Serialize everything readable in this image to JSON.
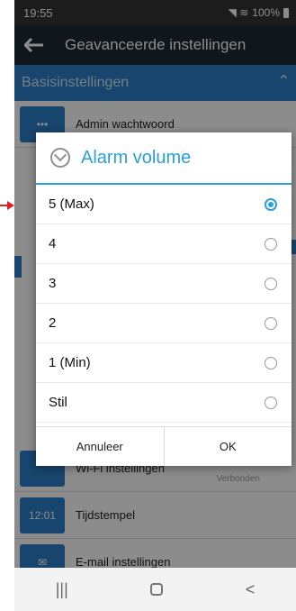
{
  "status": {
    "time": "19:55",
    "battery": "100%",
    "icons": "signal-wifi-icons"
  },
  "appbar": {
    "title": "Geavanceerde instellingen",
    "back_icon": "back-arrow-icon"
  },
  "section": {
    "title": "Basisinstellingen"
  },
  "rows": [
    {
      "label": "Admin wachtwoord",
      "icon_text": "•••",
      "sub": ""
    },
    {
      "label": "Wi-Fi instellingen",
      "icon_text": "",
      "sub": "Verbonden"
    },
    {
      "label": "Tijdstempel",
      "icon_text": "12:01",
      "sub": ""
    },
    {
      "label": "E-mail instellingen",
      "icon_text": "✉",
      "sub": ""
    }
  ],
  "dialog": {
    "title": "Alarm volume",
    "options": [
      {
        "label": "5 (Max)",
        "selected": true
      },
      {
        "label": "4",
        "selected": false
      },
      {
        "label": "3",
        "selected": false
      },
      {
        "label": "2",
        "selected": false
      },
      {
        "label": "1 (Min)",
        "selected": false
      },
      {
        "label": "Stil",
        "selected": false
      }
    ],
    "cancel": "Annuleer",
    "ok": "OK"
  },
  "navbar": {
    "recent": "|||",
    "back": "<"
  },
  "colors": {
    "accent": "#2a9fd8",
    "appbar": "#1c2a36",
    "section": "#2a7fc7"
  }
}
